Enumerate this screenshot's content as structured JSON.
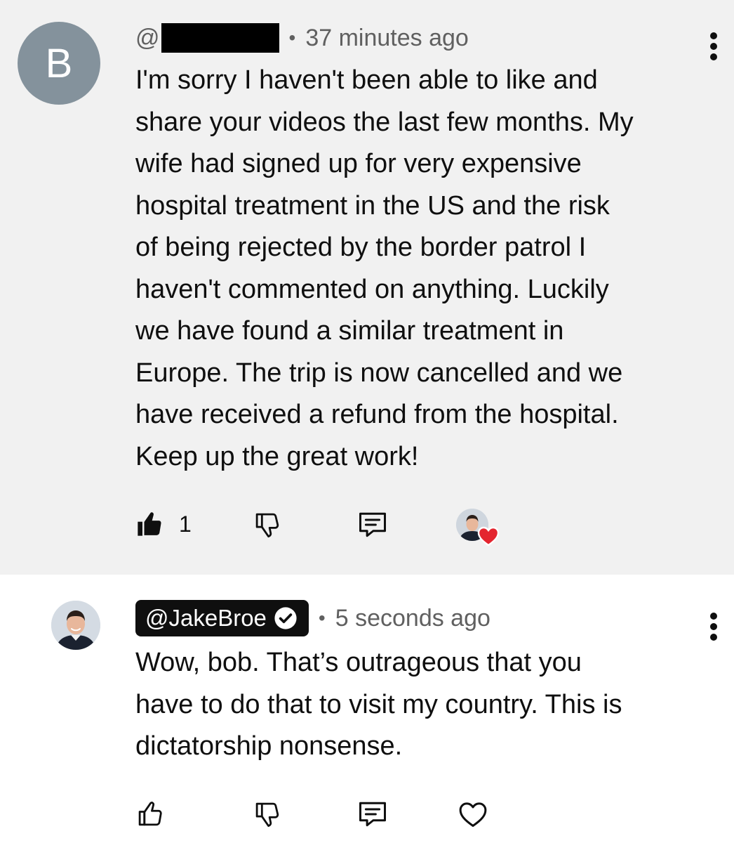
{
  "comments": [
    {
      "avatar_letter": "B",
      "handle_prefix": "@",
      "handle_redacted": true,
      "separator": "•",
      "time": "37 minutes ago",
      "text": "I'm sorry I haven't been able to like and\nshare your videos the last few months. My\nwife had signed up for very expensive\nhospital treatment in the US and the risk\nof being rejected by the border patrol I\nhaven't commented on anything. Luckily\nwe have found a similar treatment in\nEurope. The trip is now cancelled and we\nhave received a refund from the hospital.\nKeep up the great work!",
      "like_count": "1",
      "liked": true,
      "creator_hearted": true
    },
    {
      "handle": "@JakeBroe",
      "verified": true,
      "separator": "•",
      "time": "5 seconds ago",
      "text": "Wow, bob.  That’s outrageous that you\nhave to do that to visit my country.  This is\ndictatorship nonsense.",
      "liked": false
    }
  ],
  "icons": {
    "like_filled": "thumbs-up-filled-icon",
    "like_outline": "thumbs-up-outline-icon",
    "dislike": "thumbs-down-icon",
    "reply": "reply-comment-icon",
    "heart": "heart-outline-icon",
    "more": "more-vertical-icon"
  },
  "colors": {
    "highlight_bg": "#f1f1f1",
    "avatar_bg": "#84929c",
    "heart_red": "#e4252f",
    "badge_bg": "#0f0f0f"
  }
}
